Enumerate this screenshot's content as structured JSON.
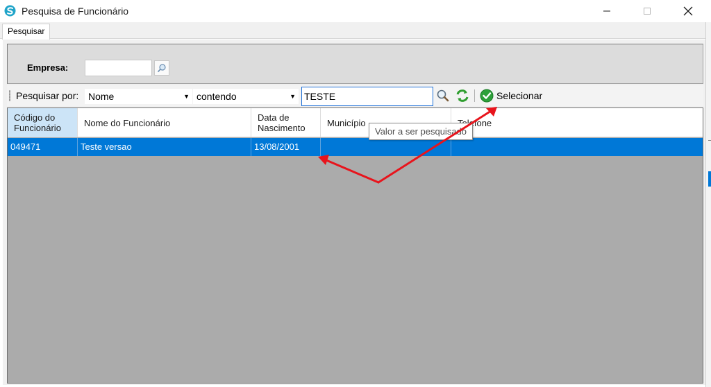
{
  "window": {
    "title": "Pesquisa de Funcionário",
    "app_icon": "app-logo-icon",
    "controls": [
      "minimize-icon",
      "maximize-icon",
      "close-icon"
    ]
  },
  "tabs": [
    {
      "label": "Pesquisar",
      "active": true
    }
  ],
  "empresa": {
    "label": "Empresa:",
    "value": ""
  },
  "toolbar": {
    "search_by_label": "Pesquisar por:",
    "field_value": "Nome",
    "operator_value": "contendo",
    "search_value": "TESTE",
    "select_label": "Selecionar"
  },
  "grid": {
    "columns": [
      "Código do Funcionário",
      "Nome do Funcionário",
      "Data de Nascimento",
      "Município",
      "Telefone"
    ],
    "rows": [
      {
        "codigo": "049471",
        "nome": "Teste versao",
        "nascimento": "13/08/2001",
        "municipio": "",
        "telefone": ""
      }
    ]
  },
  "tooltip": {
    "text": "Valor a ser pesquisado"
  },
  "colors": {
    "selection": "#0078d7",
    "annotation_arrow": "#e8141c",
    "header_first_bg": "#cce4f7",
    "grid_empty": "#ababab"
  }
}
